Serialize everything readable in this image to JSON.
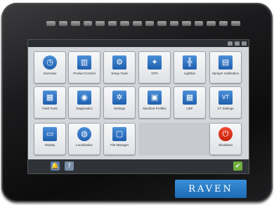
{
  "device": {
    "brand": "RAVEN",
    "led_count": 16
  },
  "screen": {
    "tiles": [
      {
        "label": "Overview",
        "icon": "clock-icon",
        "glyph": "◷",
        "round": true
      },
      {
        "label": "Product Control",
        "icon": "chart-icon",
        "glyph": "▥",
        "round": false
      },
      {
        "label": "Setup Tools",
        "icon": "wrench-icon",
        "glyph": "⚙",
        "round": false
      },
      {
        "label": "GPS",
        "icon": "satellite-icon",
        "glyph": "✦",
        "round": false
      },
      {
        "label": "Lightbar",
        "icon": "lightbar-icon",
        "glyph": "╬",
        "round": false
      },
      {
        "label": "Sprayer Calibration",
        "icon": "sprayer-icon",
        "glyph": "▤",
        "round": false
      },
      {
        "label": "Field Tools",
        "icon": "field-icon",
        "glyph": "▦",
        "round": false
      },
      {
        "label": "Diagnostics",
        "icon": "gauge-icon",
        "glyph": "◉",
        "round": false
      },
      {
        "label": "Settings",
        "icon": "gear-icon",
        "glyph": "✲",
        "round": false
      },
      {
        "label": "Machine Profiles",
        "icon": "tractor-icon",
        "glyph": "▣",
        "round": false
      },
      {
        "label": "UDF",
        "icon": "grid-icon",
        "glyph": "▦",
        "round": false
      },
      {
        "label": "VT Settings",
        "icon": "vt-icon",
        "glyph": "VT",
        "round": false
      },
      {
        "label": "Display",
        "icon": "display-icon",
        "glyph": "▭",
        "round": false
      },
      {
        "label": "Localization",
        "icon": "globe-icon",
        "glyph": "◍",
        "round": true
      },
      {
        "label": "File Manager",
        "icon": "file-icon",
        "glyph": "▢",
        "round": false
      },
      {
        "label": "Shutdown",
        "icon": "power-icon",
        "glyph": "⏻",
        "round": true,
        "red": true
      }
    ],
    "bottom": {
      "alarm_glyph": "🔔",
      "help_glyph": "?",
      "ok_glyph": "✔"
    }
  }
}
